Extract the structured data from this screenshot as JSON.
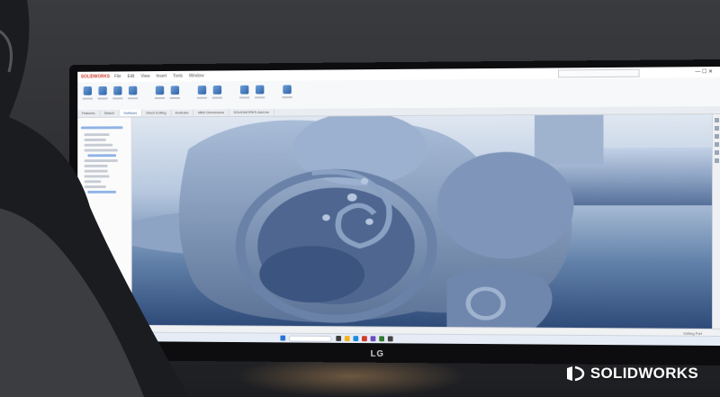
{
  "app": {
    "brand": "SOLIDWORKS",
    "menus": [
      "File",
      "Edit",
      "View",
      "Insert",
      "Tools",
      "Window"
    ],
    "document_title": "",
    "window_controls": "— ☐ ✕"
  },
  "command_tabs": [
    "Features",
    "Sketch",
    "Surfaces",
    "Direct Editing",
    "Evaluate",
    "MBD Dimensions",
    "SOLIDWORKS Add-Ins"
  ],
  "active_tab_index": 2,
  "status": {
    "text": "Editing Part"
  },
  "monitor": {
    "logo": "LG"
  },
  "watermark": {
    "text": "SOLIDWORKS"
  },
  "colors": {
    "accent": "#1f4f93",
    "brand_red": "#d23b2b",
    "model_blue": "#8fa7c7"
  }
}
